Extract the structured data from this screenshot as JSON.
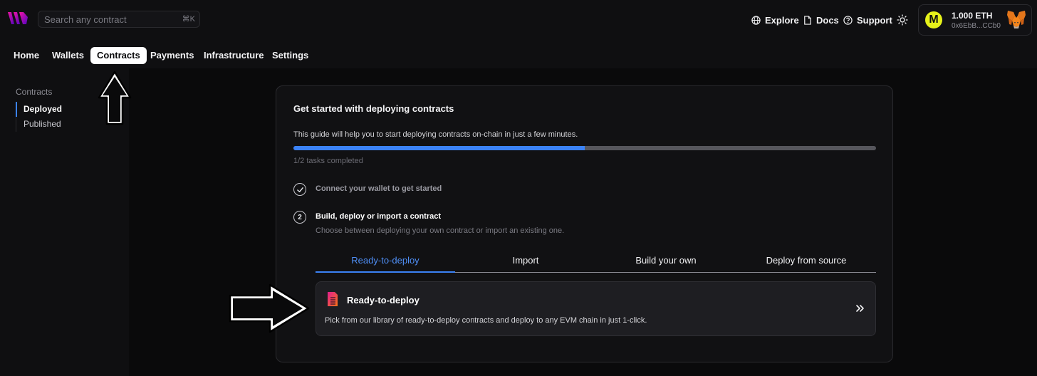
{
  "search": {
    "placeholder": "Search any contract",
    "shortcut": "⌘K"
  },
  "header_links": {
    "explore": "Explore",
    "docs": "Docs",
    "support": "Support"
  },
  "wallet": {
    "badge": "M",
    "balance": "1.000 ETH",
    "address": "0x6EbB...CCb0"
  },
  "nav": {
    "home": "Home",
    "wallets": "Wallets",
    "contracts": "Contracts",
    "payments": "Payments",
    "infrastructure": "Infrastructure",
    "settings": "Settings"
  },
  "sidebar": {
    "title": "Contracts",
    "items": [
      {
        "label": "Deployed"
      },
      {
        "label": "Published"
      }
    ]
  },
  "guide": {
    "title": "Get started with deploying contracts",
    "description": "This guide will help you to start deploying contracts on-chain in just a few minutes.",
    "progress_fraction": 0.5,
    "progress_text": "1/2 tasks completed",
    "steps": [
      {
        "title": "Connect your wallet to get started"
      },
      {
        "number": "2",
        "title": "Build, deploy or import a contract",
        "subtitle": "Choose between deploying your own contract or import an existing one."
      }
    ],
    "tabs": [
      {
        "label": "Ready-to-deploy"
      },
      {
        "label": "Import"
      },
      {
        "label": "Build your own"
      },
      {
        "label": "Deploy from source"
      }
    ],
    "option": {
      "title": "Ready-to-deploy",
      "description": "Pick from our library of ready-to-deploy contracts and deploy to any EVM chain in just 1-click."
    }
  },
  "colors": {
    "accent": "#3b82f6",
    "wallet_badge": "#e6f21a",
    "logo": "#c026d3"
  }
}
